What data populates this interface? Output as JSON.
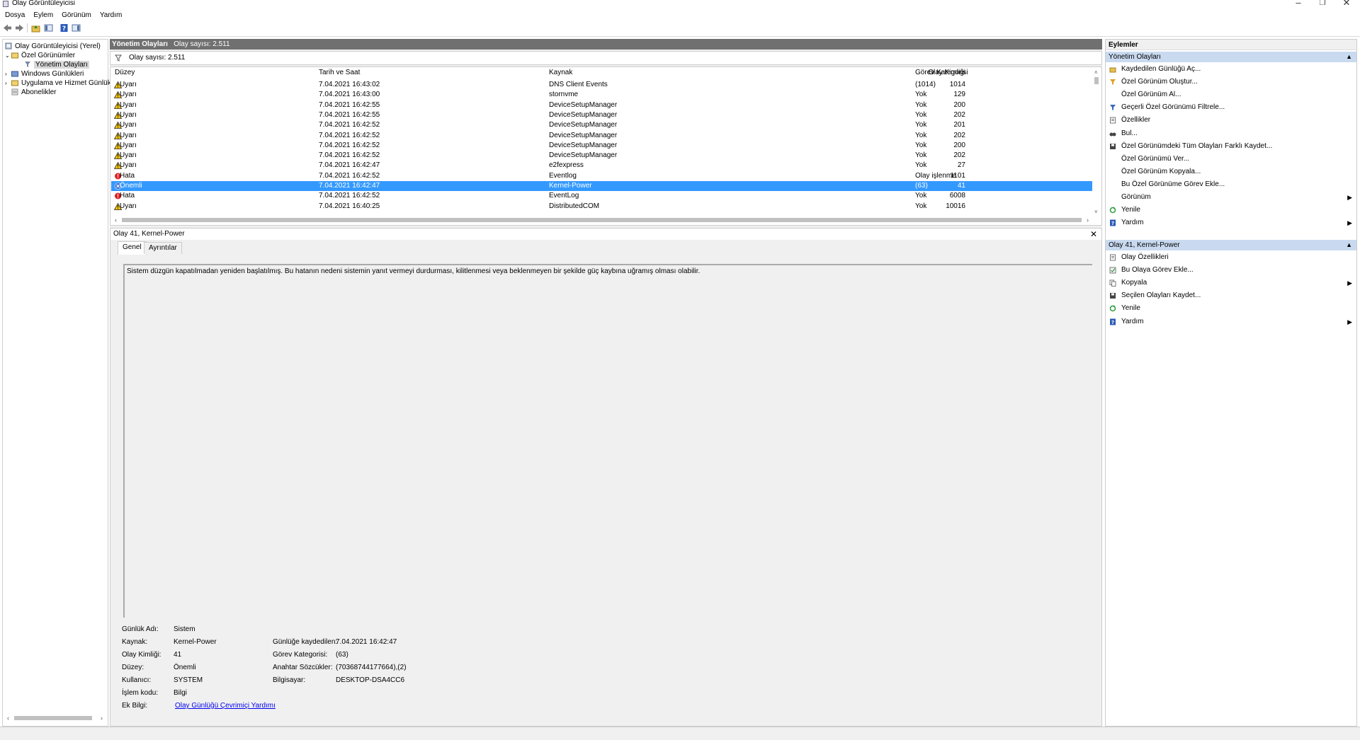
{
  "window": {
    "title": "Olay Görüntüleyicisi",
    "minimize": "–",
    "restore": "❐",
    "close": "✕"
  },
  "menu": [
    "Dosya",
    "Eylem",
    "Görünüm",
    "Yardım"
  ],
  "tree": [
    {
      "label": "Olay Görüntüleyicisi (Yerel)",
      "icon": "computer-icon"
    },
    {
      "label": "Özel Görünümler",
      "icon": "folder-icon",
      "expanded": true
    },
    {
      "label": "Yönetim Olayları",
      "icon": "filter-icon",
      "selected": true
    },
    {
      "label": "Windows Günlükleri",
      "icon": "folder-icon"
    },
    {
      "label": "Uygulama ve Hizmet Günlük",
      "icon": "folder-icon"
    },
    {
      "label": "Abonelikler",
      "icon": "subscription-icon"
    }
  ],
  "pane": {
    "title": "Yönetim Olayları",
    "count_text": "Olay sayısı: 2.511",
    "filter_text": "Olay sayısı: 2.511"
  },
  "columns": [
    "Düzey",
    "Tarih ve Saat",
    "Kaynak",
    "Olay Kimliği",
    "Görev Kategorisi"
  ],
  "events": [
    {
      "level": "Uyarı",
      "type": "warning",
      "date": "7.04.2021 16:43:02",
      "source": "DNS Client Events",
      "id": "1014",
      "category": "(1014)"
    },
    {
      "level": "Uyarı",
      "type": "warning",
      "date": "7.04.2021 16:43:00",
      "source": "stornvme",
      "id": "129",
      "category": "Yok"
    },
    {
      "level": "Uyarı",
      "type": "warning",
      "date": "7.04.2021 16:42:55",
      "source": "DeviceSetupManager",
      "id": "200",
      "category": "Yok"
    },
    {
      "level": "Uyarı",
      "type": "warning",
      "date": "7.04.2021 16:42:55",
      "source": "DeviceSetupManager",
      "id": "202",
      "category": "Yok"
    },
    {
      "level": "Uyarı",
      "type": "warning",
      "date": "7.04.2021 16:42:52",
      "source": "DeviceSetupManager",
      "id": "201",
      "category": "Yok"
    },
    {
      "level": "Uyarı",
      "type": "warning",
      "date": "7.04.2021 16:42:52",
      "source": "DeviceSetupManager",
      "id": "202",
      "category": "Yok"
    },
    {
      "level": "Uyarı",
      "type": "warning",
      "date": "7.04.2021 16:42:52",
      "source": "DeviceSetupManager",
      "id": "200",
      "category": "Yok"
    },
    {
      "level": "Uyarı",
      "type": "warning",
      "date": "7.04.2021 16:42:52",
      "source": "DeviceSetupManager",
      "id": "202",
      "category": "Yok"
    },
    {
      "level": "Uyarı",
      "type": "warning",
      "date": "7.04.2021 16:42:47",
      "source": "e2fexpress",
      "id": "27",
      "category": "Yok"
    },
    {
      "level": "Hata",
      "type": "error",
      "date": "7.04.2021 16:42:52",
      "source": "Eventlog",
      "id": "1101",
      "category": "Olay işlenme"
    },
    {
      "level": "Önemli",
      "type": "critical",
      "date": "7.04.2021 16:42:47",
      "source": "Kernel-Power",
      "id": "41",
      "category": "(63)",
      "selected": true
    },
    {
      "level": "Hata",
      "type": "error",
      "date": "7.04.2021 16:42:52",
      "source": "EventLog",
      "id": "6008",
      "category": "Yok"
    },
    {
      "level": "Uyarı",
      "type": "warning",
      "date": "7.04.2021 16:40:25",
      "source": "DistributedCOM",
      "id": "10016",
      "category": "Yok"
    }
  ],
  "detail": {
    "title": "Olay 41, Kernel-Power",
    "tabs": [
      "Genel",
      "Ayrıntılar"
    ],
    "description": "Sistem düzgün kapatılmadan yeniden başlatılmış. Bu hatanın nedeni sistemin yanıt vermeyi durdurması, kilitlenmesi veya beklenmeyen bir şekilde güç kaybına uğramış olması olabilir.",
    "props": {
      "log_name_label": "Günlük Adı:",
      "log_name": "Sistem",
      "source_label": "Kaynak:",
      "source": "Kernel-Power",
      "logged_label": "Günlüğe kaydedilen:",
      "logged": "7.04.2021 16:42:47",
      "event_id_label": "Olay Kimliği:",
      "event_id": "41",
      "task_label": "Görev Kategorisi:",
      "task": "(63)",
      "level_label": "Düzey:",
      "level": "Önemli",
      "keywords_label": "Anahtar Sözcükler:",
      "keywords": "(70368744177664),(2)",
      "user_label": "Kullanıcı:",
      "user": "SYSTEM",
      "computer_label": "Bilgisayar:",
      "computer": "DESKTOP-DSA4CC6",
      "opcode_label": "İşlem kodu:",
      "opcode": "Bilgi",
      "more_label": "Ek Bilgi:",
      "more_link": "Olay Günlüğü Çevrimiçi Yardımı"
    }
  },
  "actions": {
    "title": "Eylemler",
    "section1": "Yönetim Olayları",
    "items1": [
      {
        "label": "Kaydedilen Günlüğü Aç...",
        "icon": "open-folder-icon"
      },
      {
        "label": "Özel Görünüm Oluştur...",
        "icon": "filter-create-icon"
      },
      {
        "label": "Özel Görünüm Al...",
        "icon": ""
      },
      {
        "label": "Geçerli Özel Görünümü Filtrele...",
        "icon": "filter-icon"
      },
      {
        "label": "Özellikler",
        "icon": "properties-icon"
      },
      {
        "label": "Bul...",
        "icon": "binoculars-icon"
      },
      {
        "label": "Özel Görünümdeki Tüm Olayları Farklı Kaydet...",
        "icon": "save-icon"
      },
      {
        "label": "Özel Görünümü Ver...",
        "icon": ""
      },
      {
        "label": "Özel Görünüm Kopyala...",
        "icon": ""
      },
      {
        "label": "Bu Özel Görünüme Görev Ekle...",
        "icon": ""
      },
      {
        "label": "Görünüm",
        "icon": "",
        "submenu": true
      },
      {
        "label": "Yenile",
        "icon": "refresh-icon"
      },
      {
        "label": "Yardım",
        "icon": "help-icon",
        "submenu": true
      }
    ],
    "section2": "Olay 41, Kernel-Power",
    "items2": [
      {
        "label": "Olay Özellikleri",
        "icon": "properties-icon"
      },
      {
        "label": "Bu Olaya Görev Ekle...",
        "icon": "task-icon"
      },
      {
        "label": "Kopyala",
        "icon": "copy-icon",
        "submenu": true
      },
      {
        "label": "Seçilen Olayları Kaydet...",
        "icon": "save-icon"
      },
      {
        "label": "Yenile",
        "icon": "refresh-icon"
      },
      {
        "label": "Yardım",
        "icon": "help-icon",
        "submenu": true
      }
    ]
  },
  "colors": {
    "selection": "#3399ff",
    "header": "#707070",
    "section": "#c9daf0",
    "warning": "#f5c400",
    "error": "#d22",
    "critical": "#3a6fd8"
  }
}
